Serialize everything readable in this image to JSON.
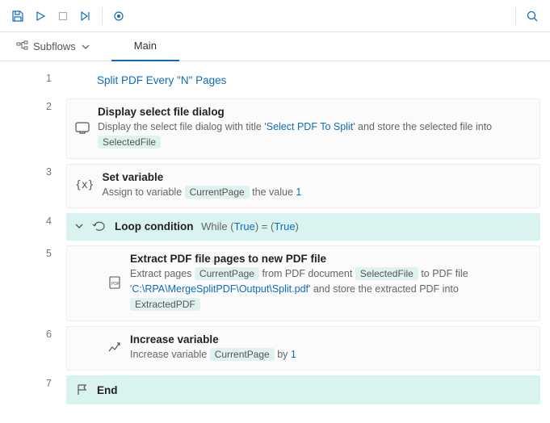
{
  "toolbar": {
    "search_tooltip": "Search"
  },
  "tabs": {
    "subflows_label": "Subflows",
    "main_label": "Main"
  },
  "flow_title": "Split PDF Every \"N\" Pages",
  "lines": {
    "l1": "1",
    "l2": "2",
    "l3": "3",
    "l4": "4",
    "l5": "5",
    "l6": "6",
    "l7": "7"
  },
  "step1": {
    "title": "Display select file dialog",
    "sub_a": "Display the select file dialog with title '",
    "sub_link": "Select PDF To Split",
    "sub_b": "' and store the selected file into",
    "chip": "SelectedFile"
  },
  "step2": {
    "title": "Set variable",
    "sub_a": "Assign to variable",
    "chip": "CurrentPage",
    "sub_b": "the value",
    "value": "1"
  },
  "loop": {
    "title": "Loop condition",
    "sub_a": "While (",
    "true1": "True",
    "eq": ") = (",
    "true2": "True",
    "close": ")"
  },
  "step4": {
    "title": "Extract PDF file pages to new PDF file",
    "sub_a": "Extract pages",
    "chip1": "CurrentPage",
    "sub_b": "from PDF document",
    "chip2": "SelectedFile",
    "sub_c": "to PDF file '",
    "path": "C:\\RPA\\MergeSplitPDF\\Output\\Split.pdf",
    "sub_d": "' and store the extracted PDF into",
    "chip3": "ExtractedPDF"
  },
  "step5": {
    "title": "Increase variable",
    "sub_a": "Increase variable",
    "chip": "CurrentPage",
    "sub_b": "by",
    "value": "1"
  },
  "end": {
    "title": "End"
  }
}
